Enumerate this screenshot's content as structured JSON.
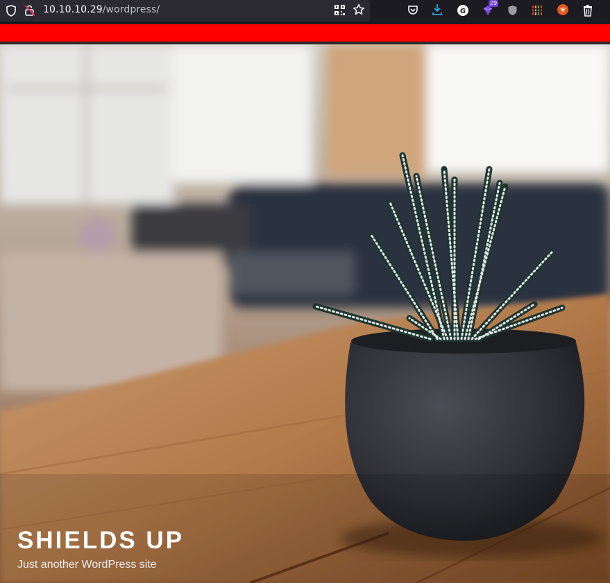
{
  "browser": {
    "url_host": "10.10.10.29",
    "url_path": "/wordpress/",
    "extension_badge": "29"
  },
  "icons": {
    "shield": "shield-icon",
    "insecure_lock": "insecure-lock-icon",
    "qr_code": "qr-code-icon",
    "bookmark_star": "bookmark-star-icon",
    "pocket": "pocket-icon",
    "downloads": "download-icon",
    "grammarly": "grammarly-icon",
    "extension_29": "extension-badge-icon",
    "shield_ext": "privacy-shield-icon",
    "equalizer": "equalizer-icon",
    "fox": "fox-extension-icon",
    "trash": "trash-icon"
  },
  "site": {
    "title": "SHIELDS UP",
    "description": "Just another WordPress site"
  },
  "colors": {
    "banner": "#ff0000",
    "toolbar": "#1c1b22",
    "urlbar": "#2b2a33"
  }
}
